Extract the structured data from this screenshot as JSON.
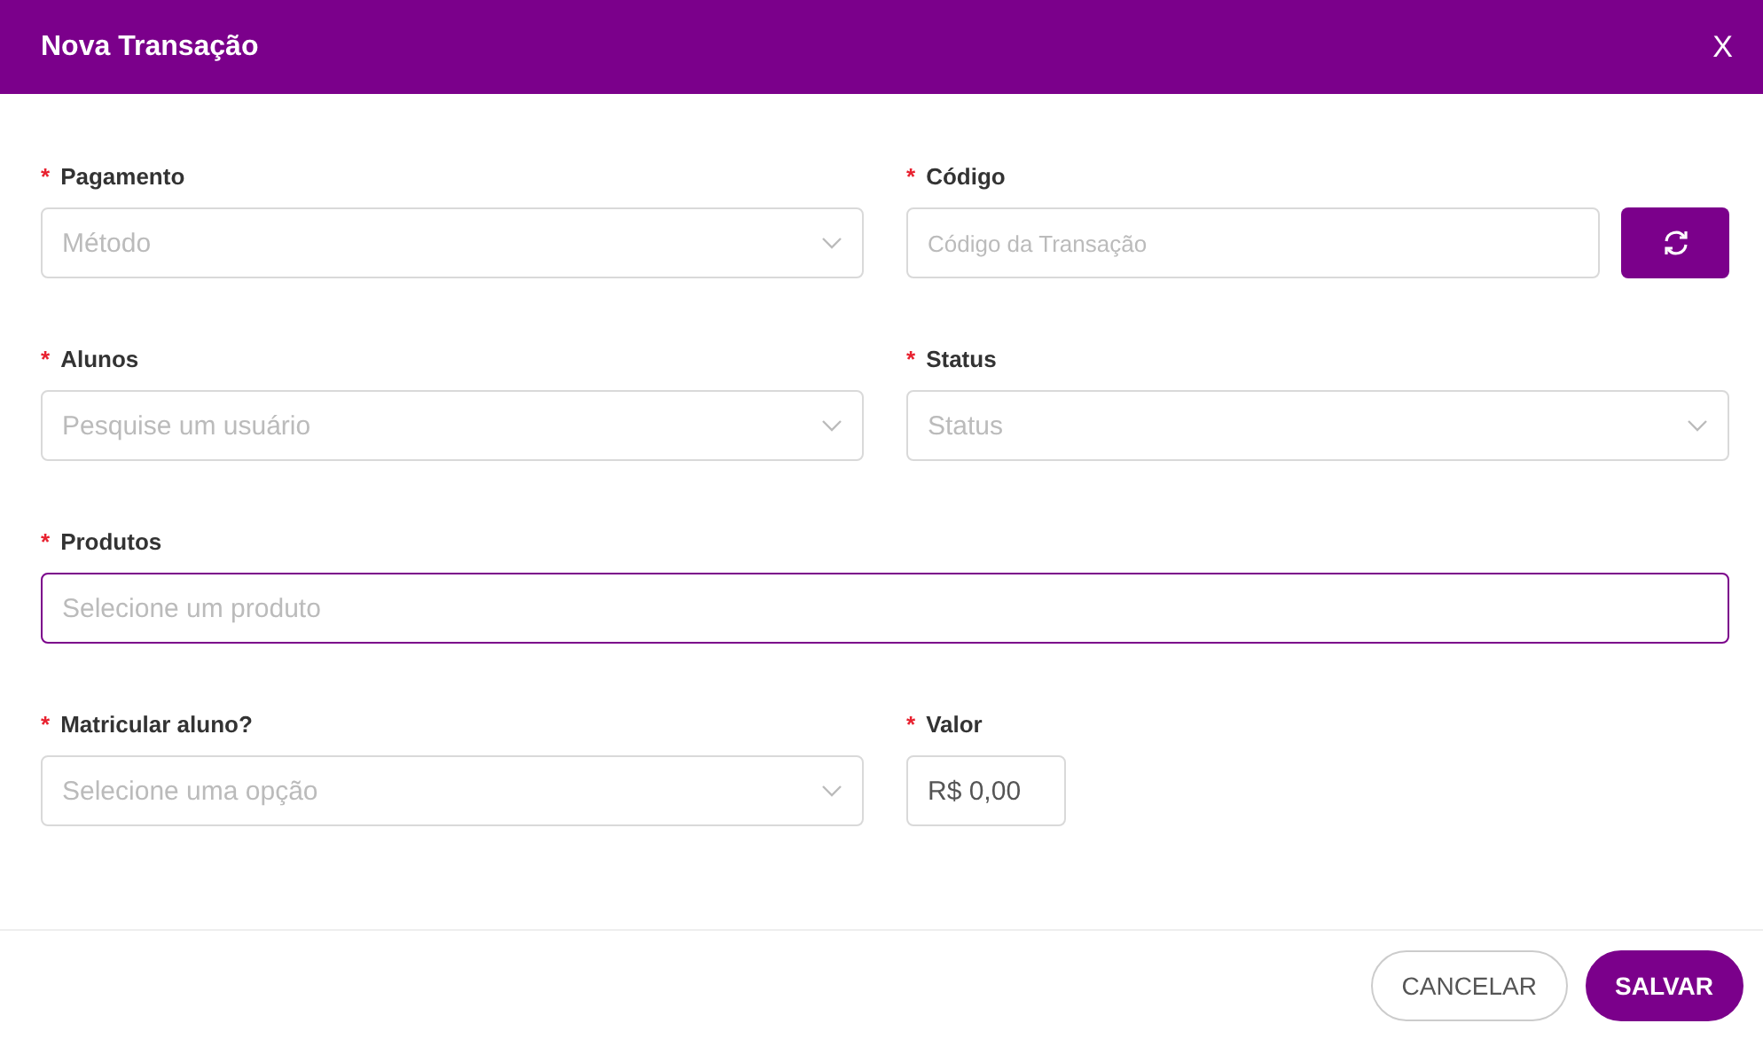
{
  "dialog": {
    "title": "Nova Transação",
    "close": "X"
  },
  "rows": [
    [
      {
        "kind": "select",
        "mark": "*",
        "label": "Pagamento",
        "placeholder": "Método",
        "focused": false
      },
      {
        "kind": "input_action",
        "mark": "*",
        "label": "Código",
        "placeholder": "Código da Transação",
        "focused": false
      }
    ],
    [
      {
        "kind": "select",
        "mark": "*",
        "label": "Alunos",
        "placeholder": "Pesquise um usuário",
        "focused": false
      },
      {
        "kind": "select",
        "mark": "*",
        "label": "Status",
        "placeholder": "Status",
        "focused": false
      }
    ],
    [
      {
        "kind": "input",
        "mark": "*",
        "label": "Produtos",
        "placeholder": "Selecione um produto",
        "focused": true
      }
    ],
    [
      {
        "kind": "select",
        "mark": "*",
        "label": "Matricular aluno?",
        "placeholder": "Selecione uma opção",
        "focused": false
      },
      {
        "kind": "money",
        "mark": "*",
        "label": "Valor",
        "value": "R$ 0,00",
        "focused": false
      }
    ]
  ],
  "buttons": [
    {
      "label": "CANCELAR",
      "kind": "secondary"
    },
    {
      "label": "SALVAR",
      "kind": "primary"
    }
  ]
}
